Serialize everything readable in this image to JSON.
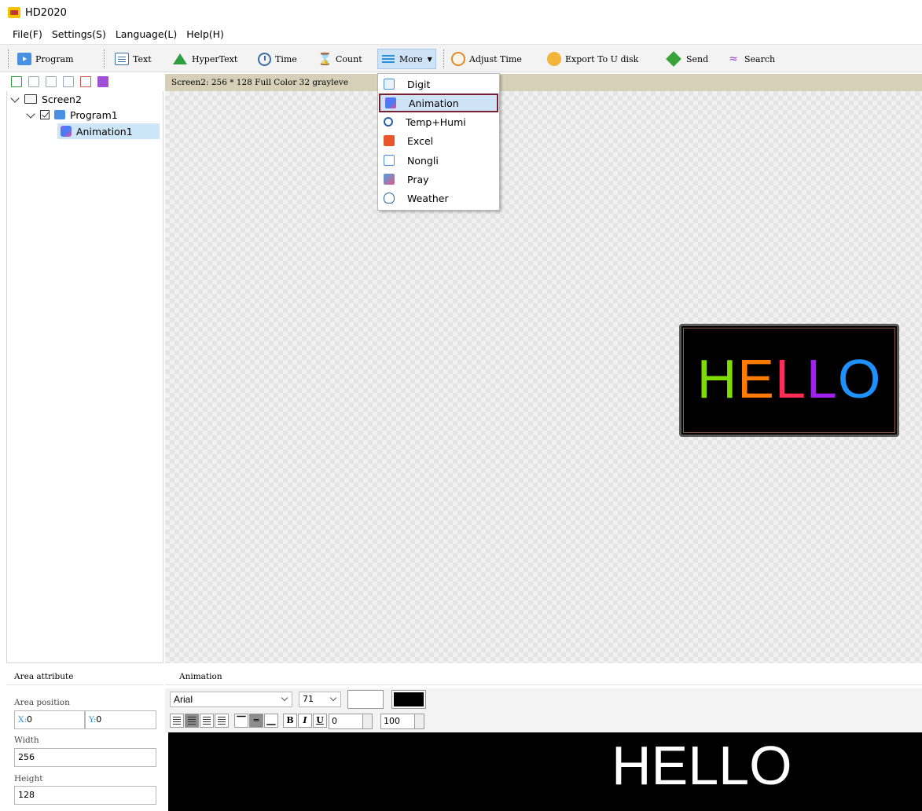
{
  "window": {
    "title": "HD2020"
  },
  "menu": [
    "File(F)",
    "Settings(S)",
    "Language(L)",
    "Help(H)"
  ],
  "toolbar": {
    "program": "Program",
    "text": "Text",
    "hypertext": "HyperText",
    "time": "Time",
    "count": "Count",
    "more": "More",
    "adjust_time": "Adjust Time",
    "export": "Export To U disk",
    "send": "Send",
    "search": "Search"
  },
  "tree": {
    "screen": "Screen2",
    "program": "Program1",
    "animation": "Animation1"
  },
  "screen_info": "Screen2: 256 * 128 Full Color 32 grayleve",
  "more_menu": [
    "Digit",
    "Animation",
    "Temp+Humi",
    "Excel",
    "Nongli",
    "Pray",
    "Weather"
  ],
  "more_menu_selected": "Animation",
  "preview": {
    "letters": [
      "H",
      "E",
      "L",
      "L",
      "O"
    ],
    "colors": [
      "#7fdc00",
      "#ff7a00",
      "#ff2d55",
      "#a020f0",
      "#1e90ff"
    ]
  },
  "area_attribute": {
    "header": "Area attribute",
    "position_label": "Area position",
    "x_label": "X:",
    "x": "0",
    "y_label": "Y:",
    "y": "0",
    "width_label": "Width",
    "width": "256",
    "height_label": "Height",
    "height": "128"
  },
  "animation_panel": {
    "header": "Animation",
    "font": "Arial",
    "size": "71",
    "spin1": "0",
    "spin2": "100",
    "bold": "B",
    "italic": "I",
    "underline": "U",
    "text": "HELLO"
  },
  "icons": [
    "program-icon",
    "text-icon",
    "hypertext-icon",
    "time-icon",
    "count-icon",
    "more-icon",
    "adjust-time-icon",
    "export-icon",
    "send-icon",
    "search-icon"
  ]
}
